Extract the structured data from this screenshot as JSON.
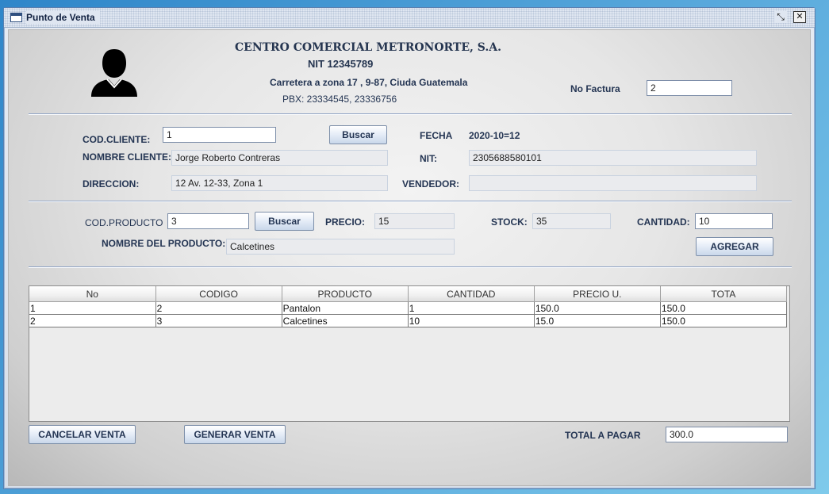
{
  "window": {
    "title": "Punto de Venta"
  },
  "company": {
    "name": "CENTRO COMERCIAL METRONORTE, S.A.",
    "nit": "NIT 12345789",
    "address": "Carretera a zona 17 , 9-87, Ciuda Guatemala",
    "phone": "PBX: 23334545, 23336756"
  },
  "invoice": {
    "label": "No Factura",
    "value": "2"
  },
  "client": {
    "code_label": "COD.CLIENTE:",
    "code_value": "1",
    "search_label": "Buscar",
    "date_label": "FECHA",
    "date_value": "2020-10=12",
    "name_label": "NOMBRE CLIENTE:",
    "name_value": "Jorge Roberto Contreras",
    "nit_label": "NIT:",
    "nit_value": "2305688580101",
    "address_label": "DIRECCION:",
    "address_value": "12 Av. 12-33, Zona 1",
    "seller_label": "VENDEDOR:",
    "seller_value": ""
  },
  "product": {
    "code_label": "COD.PRODUCTO",
    "code_value": "3",
    "search_label": "Buscar",
    "price_label": "PRECIO:",
    "price_value": "15",
    "stock_label": "STOCK:",
    "stock_value": "35",
    "qty_label": "CANTIDAD:",
    "qty_value": "10",
    "name_label": "NOMBRE DEL PRODUCTO:",
    "name_value": "Calcetines",
    "add_label": "AGREGAR"
  },
  "table": {
    "columns": [
      "No",
      "CODIGO",
      "PRODUCTO",
      "CANTIDAD",
      "PRECIO U.",
      "TOTA"
    ],
    "rows": [
      [
        "1",
        "2",
        "Pantalon",
        "1",
        "150.0",
        "150.0"
      ],
      [
        "2",
        "3",
        "Calcetines",
        "10",
        "15.0",
        "150.0"
      ]
    ]
  },
  "footer": {
    "cancel_label": "CANCELAR VENTA",
    "generate_label": "GENERAR VENTA",
    "total_label": "TOTAL A PAGAR",
    "total_value": "300.0"
  },
  "icons": {
    "user": "user-avatar-icon",
    "window": "window-icon",
    "restore": "restore-icon",
    "close": "close-icon"
  },
  "colors": {
    "accent": "#243553",
    "separator": "#8ea2c4"
  }
}
